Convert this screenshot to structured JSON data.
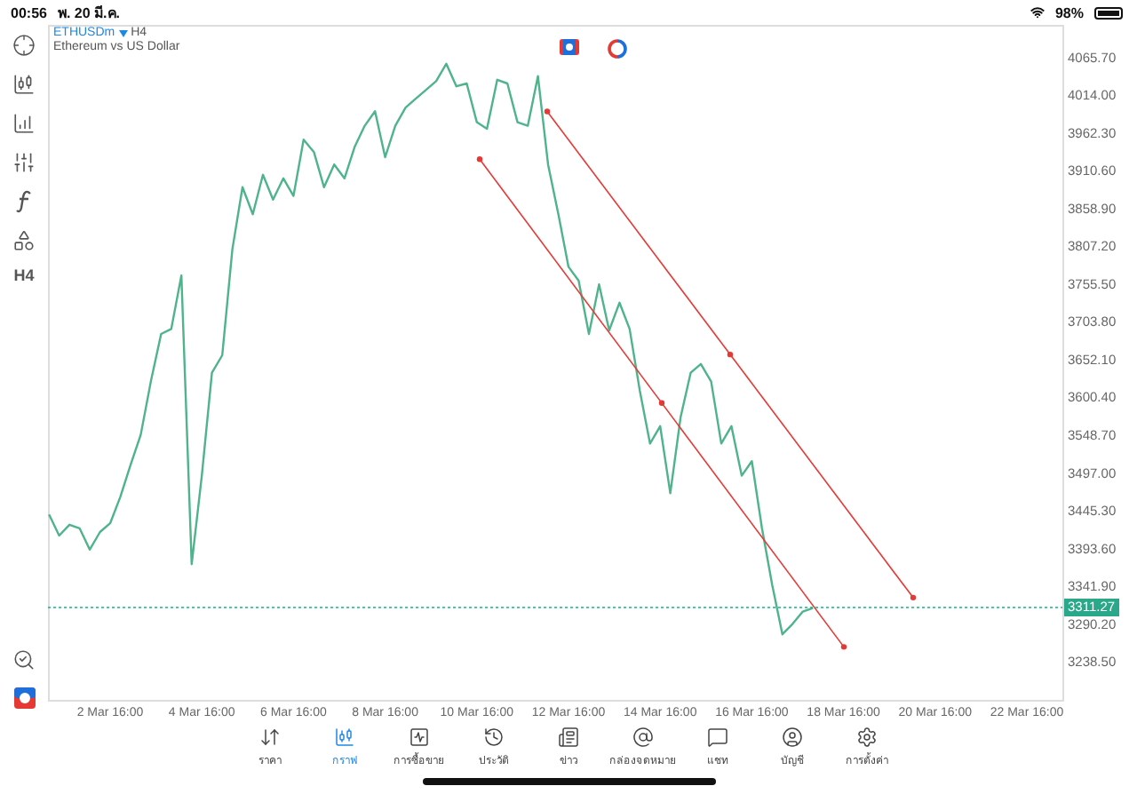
{
  "status_bar": {
    "time": "00:56",
    "date": "พ. 20 มี.ค.",
    "battery": "98%"
  },
  "legend": {
    "symbol": "ETHUSDm",
    "timeframe": "H4",
    "description": "Ethereum vs US Dollar"
  },
  "toolbar": {
    "timeframe": "H4"
  },
  "chart": {
    "chart_data": {
      "type": "line",
      "categories": [
        null,
        null,
        null,
        null,
        null,
        null,
        "2 Mar 16:00",
        null,
        null,
        null,
        null,
        null,
        null,
        null,
        null,
        "4 Mar 16:00",
        null,
        null,
        null,
        null,
        null,
        null,
        null,
        null,
        "6 Mar 16:00",
        null,
        null,
        null,
        null,
        null,
        null,
        null,
        null,
        "8 Mar 16:00",
        null,
        null,
        null,
        null,
        null,
        null,
        null,
        null,
        "10 Mar 16:00",
        null,
        null,
        null,
        null,
        null,
        null,
        null,
        null,
        "12 Mar 16:00",
        null,
        null,
        null,
        null,
        null,
        null,
        null,
        null,
        "14 Mar 16:00",
        null,
        null,
        null,
        null,
        null,
        null,
        null,
        null,
        "16 Mar 16:00",
        null,
        null,
        null,
        null,
        null,
        null,
        null,
        null,
        "18 Mar 16:00",
        null,
        null,
        null,
        null,
        null,
        null,
        null,
        null,
        "20 Mar 16:00",
        null,
        null,
        null,
        null,
        null,
        null,
        null,
        null,
        "22 Mar 16:00"
      ],
      "series": [
        {
          "color": "#4fb38c",
          "values": [
            3439,
            3410,
            3425,
            3420,
            3391,
            3415,
            3427,
            3463,
            3507,
            3548,
            3621,
            3686,
            3693,
            3766,
            3371,
            3492,
            3633,
            3657,
            3802,
            3887,
            3850,
            3904,
            3870,
            3899,
            3875,
            3952,
            3935,
            3887,
            3918,
            3899,
            3942,
            3971,
            3991,
            3928,
            3971,
            3996,
            4008,
            4020,
            4032,
            4056,
            4025,
            4029,
            3976,
            3967,
            4034,
            4029,
            3976,
            3971,
            4039,
            3918,
            3850,
            3778,
            3759,
            3686,
            3754,
            3691,
            3729,
            3693,
            3609,
            3536,
            3560,
            3468,
            3572,
            3633,
            3645,
            3621,
            3536,
            3560,
            3492,
            3512,
            3420,
            3342,
            3275,
            3289,
            3306,
            3311,
            null,
            null,
            null,
            null,
            null,
            null,
            null,
            null,
            null,
            null,
            null,
            null,
            null,
            null,
            null,
            null,
            null,
            null,
            null,
            null,
            null
          ]
        }
      ],
      "ylim": [
        3185.2,
        4109.2
      ],
      "yticks": [
        {
          "value": 4065.7,
          "label": "4065.70"
        },
        {
          "value": 4014.0,
          "label": "4014.00"
        },
        {
          "value": 3962.3,
          "label": "3962.30"
        },
        {
          "value": 3910.6,
          "label": "3910.60"
        },
        {
          "value": 3858.9,
          "label": "3858.90"
        },
        {
          "value": 3807.2,
          "label": "3807.20"
        },
        {
          "value": 3755.5,
          "label": "3755.50"
        },
        {
          "value": 3703.8,
          "label": "3703.80"
        },
        {
          "value": 3652.1,
          "label": "3652.10"
        },
        {
          "value": 3600.4,
          "label": "3600.40"
        },
        {
          "value": 3548.7,
          "label": "3548.70"
        },
        {
          "value": 3497.0,
          "label": "3497.00"
        },
        {
          "value": 3445.3,
          "label": "3445.30"
        },
        {
          "value": 3393.6,
          "label": "3393.60"
        },
        {
          "value": 3341.9,
          "label": "3341.90"
        },
        {
          "value": 3290.2,
          "label": "3290.20"
        },
        {
          "value": 3238.5,
          "label": "3238.50"
        }
      ]
    }
  },
  "current_price": {
    "label": "3311.27"
  },
  "tabs": [
    {
      "label": "ราคา",
      "selected": false
    },
    {
      "label": "กราฟ",
      "selected": true
    },
    {
      "label": "การซื้อขาย",
      "selected": false
    },
    {
      "label": "ประวัติ",
      "selected": false
    },
    {
      "label": "ข่าว",
      "selected": false
    },
    {
      "label": "กล่องจดหมาย",
      "selected": false
    },
    {
      "label": "แชท",
      "selected": false
    },
    {
      "label": "บัญชี",
      "selected": false
    },
    {
      "label": "การตั้งค่า",
      "selected": false
    }
  ]
}
